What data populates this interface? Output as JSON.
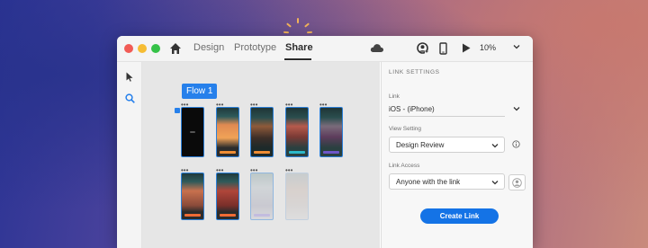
{
  "tabs": {
    "design": "Design",
    "prototype": "Prototype",
    "share": "Share"
  },
  "toolbar": {
    "zoom": "10%"
  },
  "canvas": {
    "flow_label": "Flow 1"
  },
  "panel": {
    "title": "LINK SETTINGS",
    "link_label": "Link",
    "link_value": "iOS - (iPhone)",
    "view_setting_label": "View Setting",
    "view_setting_value": "Design Review",
    "link_access_label": "Link Access",
    "link_access_value": "Anyone with the link",
    "create_link_label": "Create Link"
  },
  "colors": {
    "accent": "#2680eb",
    "button": "#1473e6"
  },
  "icons": [
    "home-icon",
    "cloud-icon",
    "user-icon",
    "phone-icon",
    "play-icon",
    "chevron-down-icon",
    "pointer-icon",
    "search-icon",
    "info-icon",
    "avatar-icon"
  ]
}
